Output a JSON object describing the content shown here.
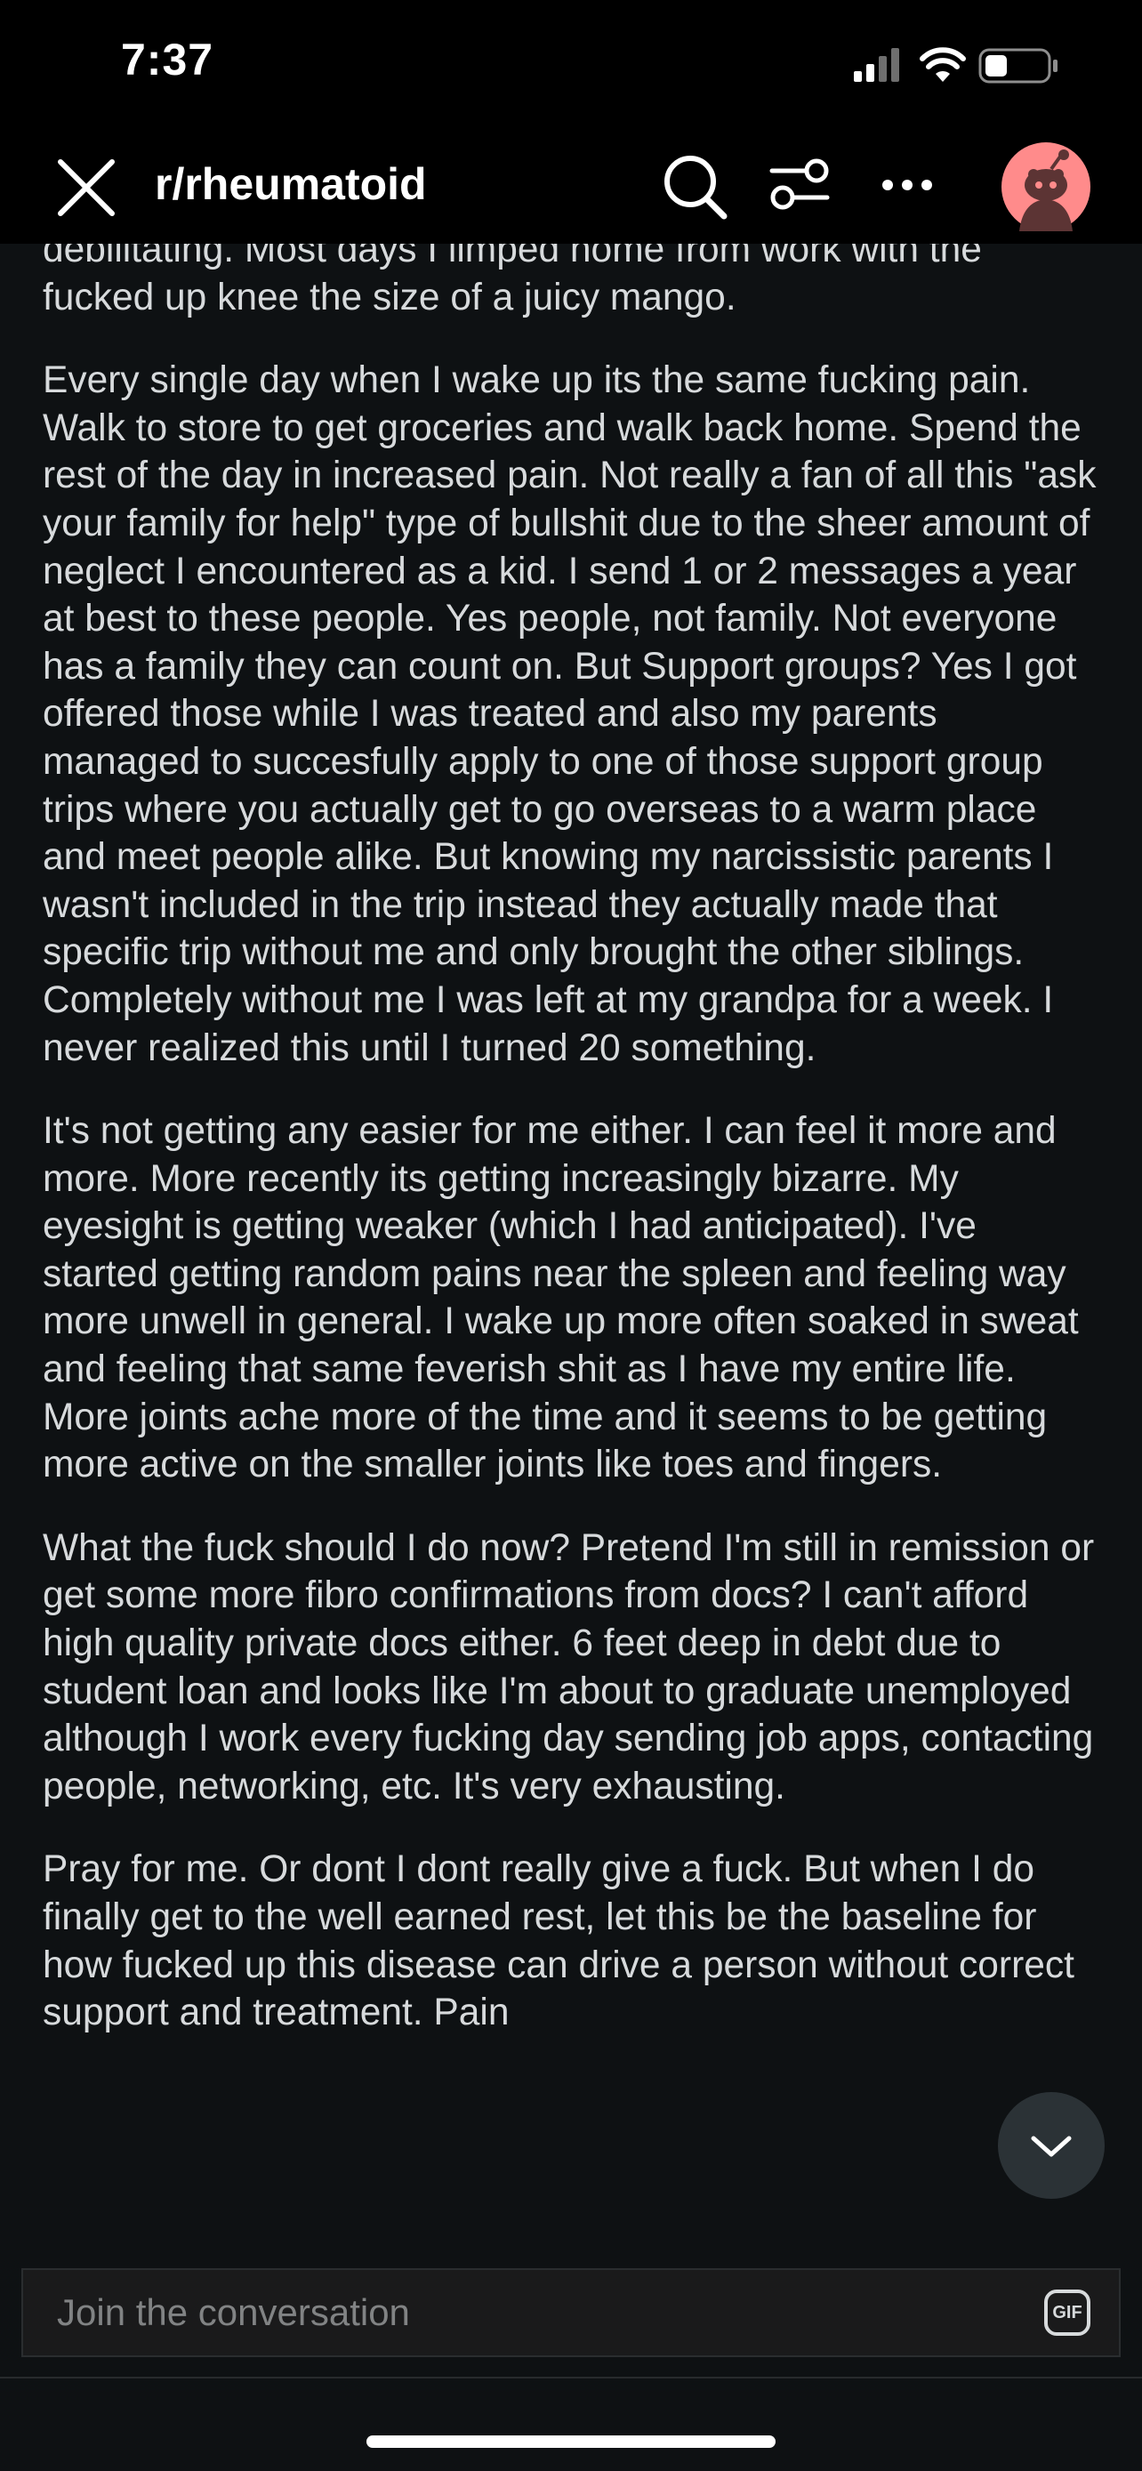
{
  "status_bar": {
    "time": "7:37",
    "icons": [
      "cellular-signal-icon",
      "wifi-icon",
      "battery-icon"
    ]
  },
  "nav": {
    "title": "r/rheumatoid",
    "icons": [
      "close-icon",
      "search-icon",
      "filter-icon",
      "more-icon",
      "avatar"
    ],
    "accent_color": "#ff8b8b"
  },
  "post": {
    "paragraphs": [
      "debilitating. Most days I limped home from work with the fucked up knee the size of a juicy mango.",
      "Every single day when I wake up its the same fucking pain. Walk to store to get groceries and walk back home. Spend the rest of the day in increased pain. Not really a fan of all this \"ask your family for help\" type of bullshit due to the sheer amount of neglect I encountered as a kid. I send 1 or 2 messages a year at best to these people. Yes people, not family. Not everyone has a family they can count on. But Support groups? Yes I got offered those while I was treated and also my parents managed to succesfully apply to one of those support group trips where you actually get to go overseas to a warm place and meet people alike. But knowing my narcissistic parents I wasn't included in the trip instead they actually made that specific trip without me and only brought the other siblings. Completely without me I was left at my grandpa for a week. I never realized this until I turned 20 something.",
      "It's not getting any easier for me either. I can feel it more and more. More recently its getting increasingly bizarre. My eyesight is getting weaker (which I had anticipated). I've started getting random pains near the spleen and feeling way more unwell in general. I wake up more often soaked in sweat and feeling that same feverish shit as I have my entire life. More joints ache more of the time and it seems to be getting more active on the smaller joints like toes and fingers.",
      "What the fuck should I do now? Pretend I'm still in remission or get some more fibro confirmations from docs? I can't afford high quality private docs either. 6 feet deep in debt due to student loan and looks like I'm about to graduate unemployed although I work every fucking day sending job apps, contacting people, networking, etc. It's very exhausting.",
      "Pray for me. Or dont I dont really give a fuck. But when I do finally get to the well earned rest, let this be the baseline for how fucked up this disease can drive a person without correct support and treatment. Pain"
    ]
  },
  "scroll_button": {
    "icon": "chevron-down-icon"
  },
  "composer": {
    "placeholder": "Join the conversation",
    "gif_label": "GIF"
  }
}
